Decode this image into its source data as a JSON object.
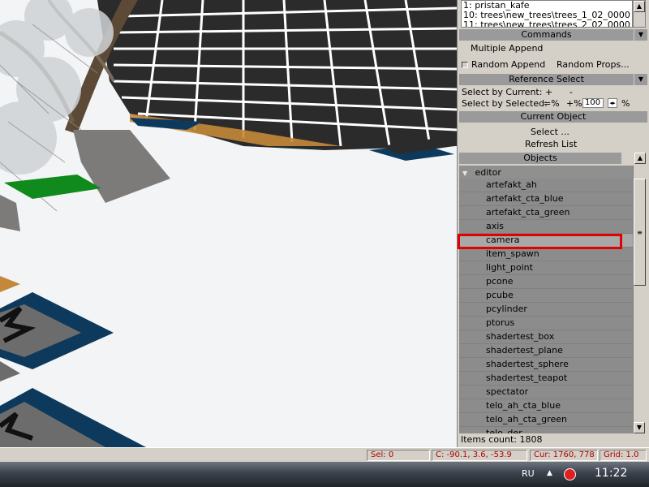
{
  "top_list": {
    "items": [
      "1: pristan_kafe",
      "10: trees\\new_trees\\trees_1_02_0000",
      "11: trees\\new_trees\\trees_2_02_0000"
    ]
  },
  "commands": {
    "header": "Commands",
    "multiple_append": "Multiple Append",
    "random_append": "Random Append",
    "random_props": "Random Props..."
  },
  "reference_select": {
    "header": "Reference Select",
    "by_current_label": "Select by Current:",
    "by_current_plus": "+",
    "by_current_minus": "-",
    "by_selected_label": "Select by Selected:",
    "eq_pct": "=%",
    "plus_pct": "+%",
    "value": "100",
    "pct": "%"
  },
  "current_object": {
    "header": "Current Object",
    "select_button": "Select ...",
    "refresh_button": "Refresh List"
  },
  "objects": {
    "header": "Objects",
    "root": "editor",
    "items": [
      "artefakt_ah",
      "artefakt_cta_blue",
      "artefakt_cta_green",
      "axis",
      "camera",
      "item_spawn",
      "light_point",
      "pcone",
      "pcube",
      "pcylinder",
      "ptorus",
      "shadertest_box",
      "shadertest_plane",
      "shadertest_sphere",
      "shadertest_teapot",
      "spectator",
      "telo_ah_cta_blue",
      "telo_ah_cta_green",
      "telo_der..."
    ],
    "selected": "camera",
    "items_count": "Items count: 1808"
  },
  "status": {
    "sel": "Sel: 0",
    "coords": "C: -90.1, 3.6, -53.9",
    "cursor": "Cur: 1760, 778",
    "grid": "Grid: 1.0"
  },
  "taskbar": {
    "lang": "RU",
    "clock": "11:22"
  },
  "colors": {
    "highlight": "#e30000",
    "status_text": "#b00000",
    "header_bg": "#9a9a9a"
  }
}
